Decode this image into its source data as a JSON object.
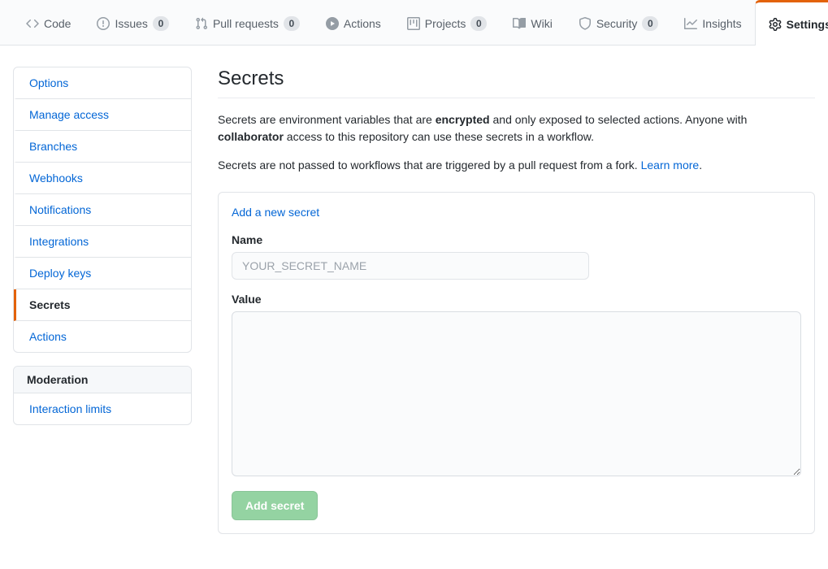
{
  "repo_nav": {
    "tabs": [
      {
        "label": "Code",
        "icon": "code-icon",
        "count": null,
        "active": false
      },
      {
        "label": "Issues",
        "icon": "issue-icon",
        "count": "0",
        "active": false
      },
      {
        "label": "Pull requests",
        "icon": "pull-request-icon",
        "count": "0",
        "active": false
      },
      {
        "label": "Actions",
        "icon": "play-icon",
        "count": null,
        "active": false
      },
      {
        "label": "Projects",
        "icon": "project-icon",
        "count": "0",
        "active": false
      },
      {
        "label": "Wiki",
        "icon": "book-icon",
        "count": null,
        "active": false
      },
      {
        "label": "Security",
        "icon": "shield-icon",
        "count": "0",
        "active": false
      },
      {
        "label": "Insights",
        "icon": "graph-icon",
        "count": null,
        "active": false
      },
      {
        "label": "Settings",
        "icon": "gear-icon",
        "count": null,
        "active": true
      }
    ],
    "active_accent_color": "#e36209"
  },
  "sidebar": {
    "menu_items": [
      {
        "label": "Options",
        "selected": false
      },
      {
        "label": "Manage access",
        "selected": false
      },
      {
        "label": "Branches",
        "selected": false
      },
      {
        "label": "Webhooks",
        "selected": false
      },
      {
        "label": "Notifications",
        "selected": false
      },
      {
        "label": "Integrations",
        "selected": false
      },
      {
        "label": "Deploy keys",
        "selected": false
      },
      {
        "label": "Secrets",
        "selected": true
      },
      {
        "label": "Actions",
        "selected": false
      }
    ],
    "moderation": {
      "heading": "Moderation",
      "items": [
        {
          "label": "Interaction limits"
        }
      ]
    }
  },
  "main": {
    "title": "Secrets",
    "description_1": {
      "part_1": "Secrets are environment variables that are ",
      "bold_1": "encrypted",
      "part_2": " and only exposed to selected actions. Anyone with ",
      "bold_2": "collaborator",
      "part_3": " access to this repository can use these secrets in a workflow."
    },
    "description_2": {
      "text": "Secrets are not passed to workflows that are triggered by a pull request from a fork. ",
      "link_label": "Learn more",
      "period": "."
    },
    "add_secret_panel": {
      "header_link": "Add a new secret",
      "name_label": "Name",
      "name_value": "",
      "name_placeholder": "YOUR_SECRET_NAME",
      "value_label": "Value",
      "value_value": "",
      "submit_label": "Add secret",
      "submit_color": "#94d3a2",
      "submit_disabled": true
    }
  }
}
